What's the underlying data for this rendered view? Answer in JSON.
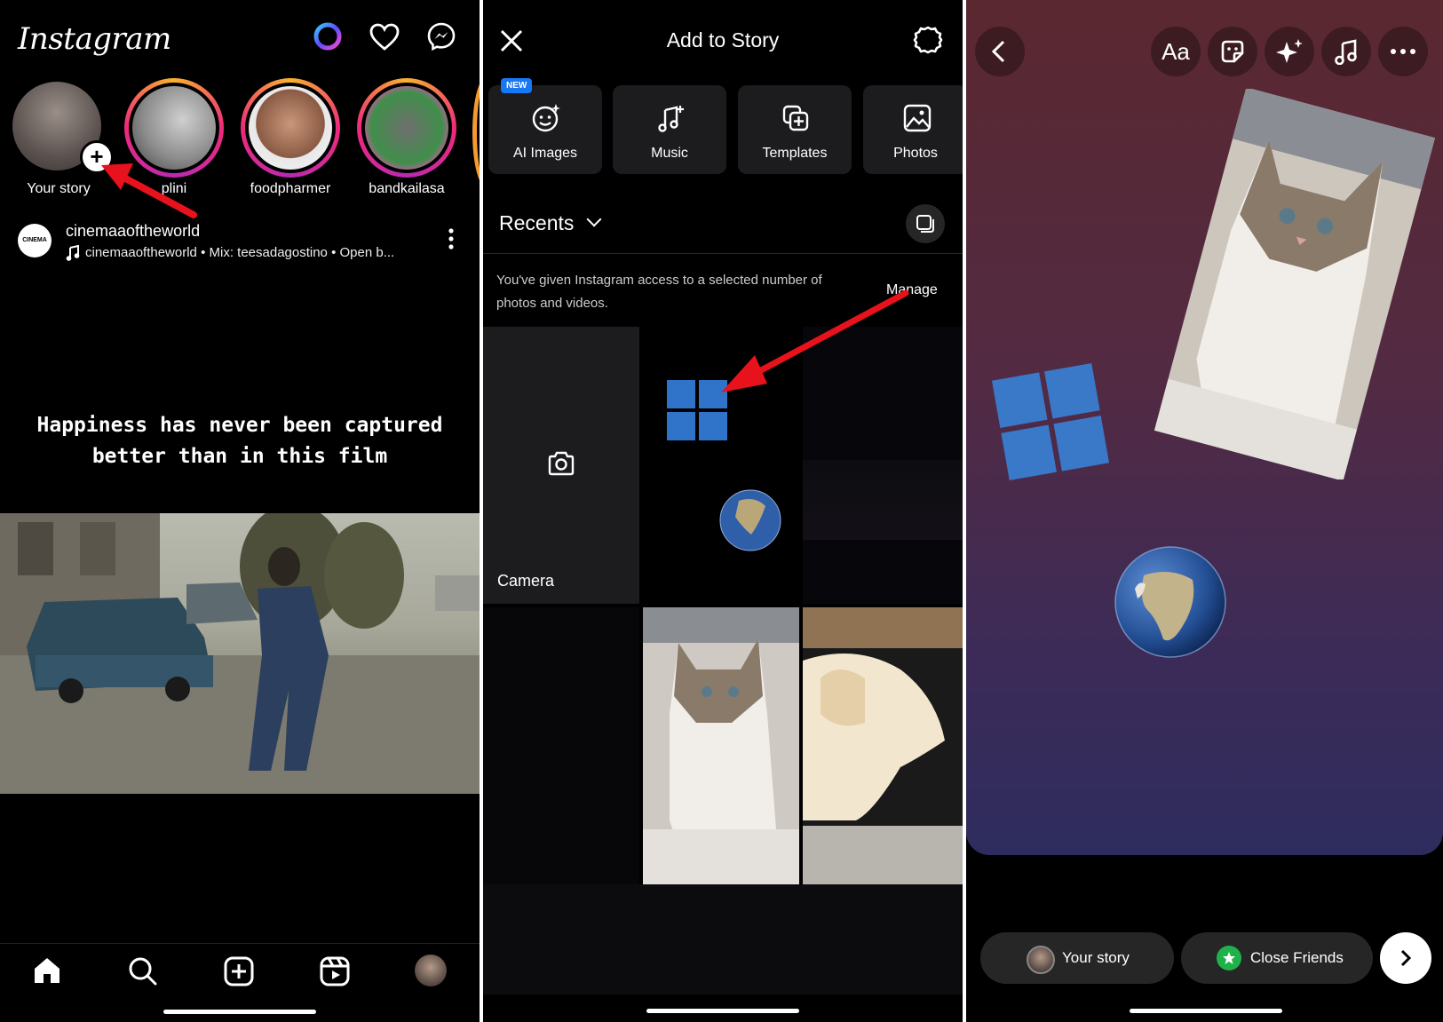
{
  "panel1": {
    "logo": "Instagram",
    "stories": [
      {
        "label": "Your story"
      },
      {
        "label": "plini"
      },
      {
        "label": "foodpharmer"
      },
      {
        "label": "bandkailasa"
      }
    ],
    "post": {
      "avatar_text": "CINEMA",
      "username": "cinemaaoftheworld",
      "subtitle": "cinemaaoftheworld • Mix:  teesadagostino • Open b..."
    },
    "caption_line1": "Happiness has never been captured",
    "caption_line2": "better than in this film",
    "nav_icons": [
      "home-icon",
      "search-icon",
      "create-icon",
      "reels-icon",
      "profile-avatar"
    ]
  },
  "panel2": {
    "title": "Add to Story",
    "new_badge": "NEW",
    "tiles": [
      {
        "label": "AI Images",
        "icon": "sparkle-face-icon"
      },
      {
        "label": "Music",
        "icon": "music-note-icon"
      },
      {
        "label": "Templates",
        "icon": "templates-icon"
      },
      {
        "label": "Photos",
        "icon": "photos-icon"
      }
    ],
    "recents_label": "Recents",
    "access_text": "You've given Instagram access to a selected number of photos and videos.",
    "manage_label": "Manage",
    "camera_label": "Camera"
  },
  "panel3": {
    "share_your_story": "Your story",
    "share_close_friends": "Close Friends",
    "text_tool": "Aa",
    "toolbar_icons": [
      "back-icon",
      "text-tool",
      "sticker-icon",
      "effects-icon",
      "music-icon",
      "more-icon"
    ]
  },
  "colors": {
    "arrow_red": "#e8121c",
    "windows_blue": "#2f74c9",
    "close_friends_green": "#1fb24a"
  }
}
